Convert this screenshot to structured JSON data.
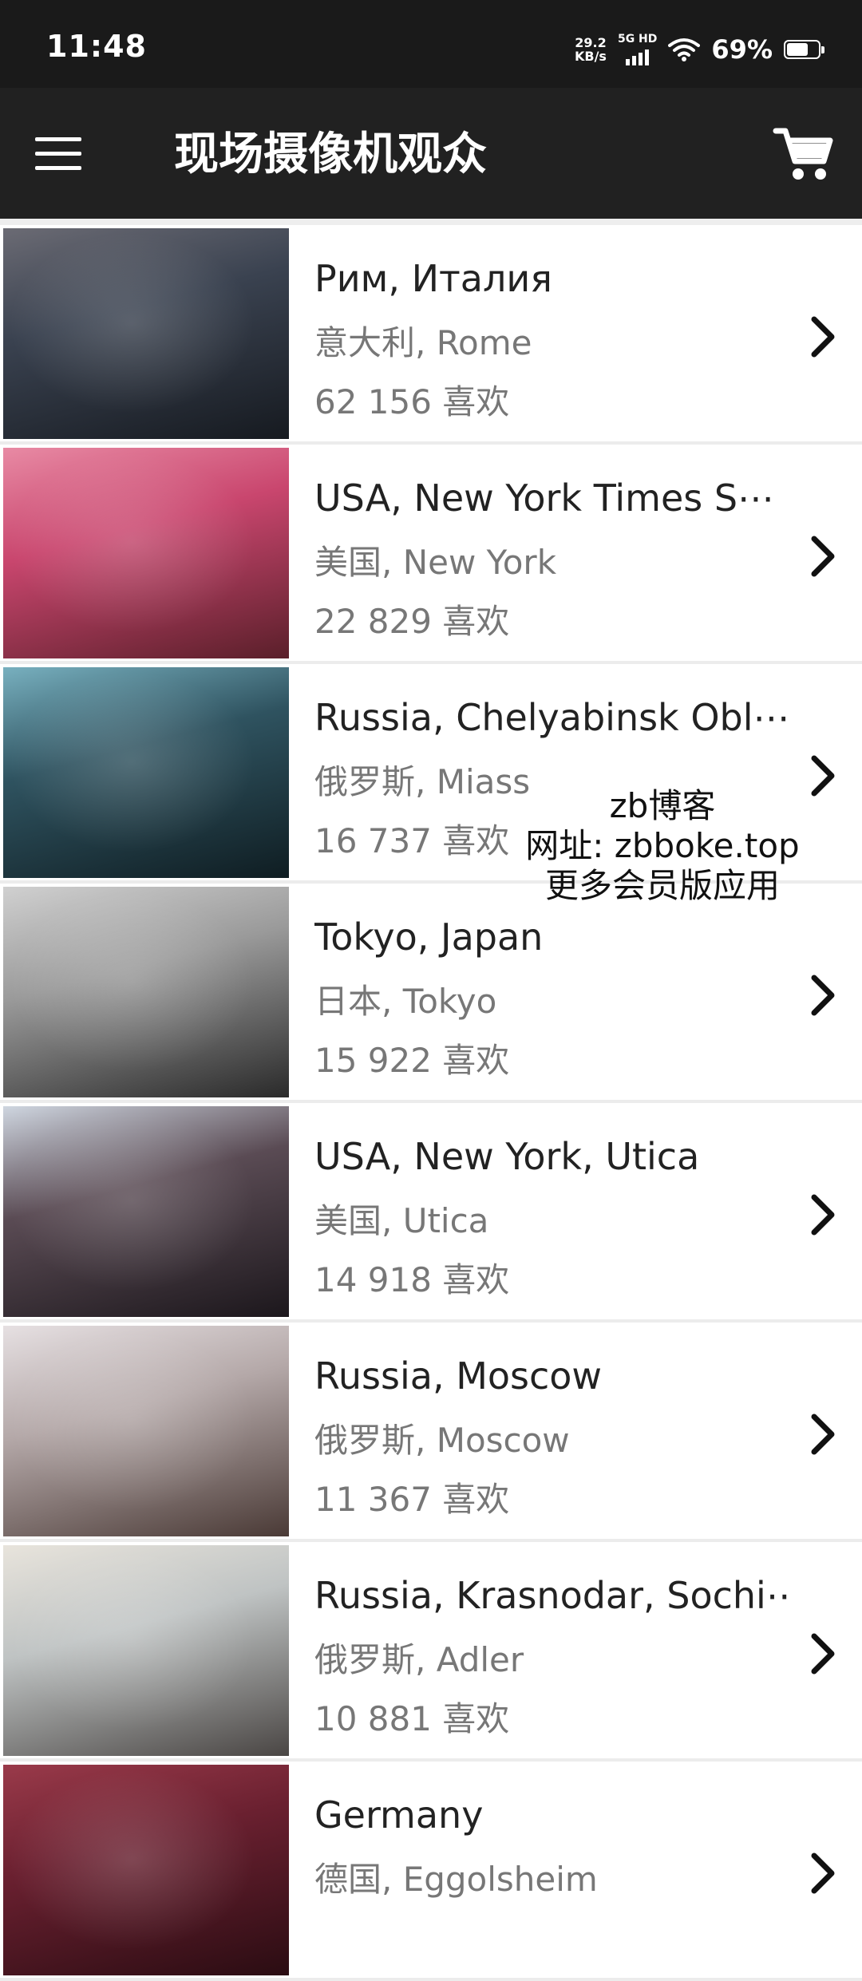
{
  "status": {
    "time": "11:48",
    "net_speed_value": "29.2",
    "net_speed_unit": "KB/s",
    "network": "5G HD",
    "battery_percent": "69%",
    "battery_level": 0.69
  },
  "app_bar": {
    "title": "现场摄像机观众",
    "menu_icon": "hamburger-menu-icon",
    "cart_icon": "shopping-cart-icon"
  },
  "cameras": [
    {
      "title": "Рим, Италия",
      "location": "意大利, Rome",
      "likes": "62 156 喜欢",
      "thumb_colors": [
        "#3a4250",
        "#161a20",
        "#6b6b74"
      ]
    },
    {
      "title": "USA, New York Times S⋯",
      "location": "美国, New York",
      "likes": "22 829 喜欢",
      "thumb_colors": [
        "#c9466e",
        "#5a1f2a",
        "#e88aa4"
      ]
    },
    {
      "title": "Russia, Chelyabinsk Obl⋯",
      "location": "俄罗斯, Miass",
      "likes": "16 737 喜欢",
      "thumb_colors": [
        "#2f5360",
        "#0f1d22",
        "#78b0bf"
      ]
    },
    {
      "title": "Tokyo, Japan",
      "location": "日本, Tokyo",
      "likes": "15 922 喜欢",
      "thumb_colors": [
        "#9a9a9a",
        "#2a2a2a",
        "#d0d0d0"
      ]
    },
    {
      "title": "USA, New York, Utica",
      "location": "美国, Utica",
      "likes": "14 918 喜欢",
      "thumb_colors": [
        "#5a4b54",
        "#1c171c",
        "#cfd6e0"
      ]
    },
    {
      "title": "Russia, Moscow",
      "location": "俄罗斯, Moscow",
      "likes": "11 367 喜欢",
      "thumb_colors": [
        "#b4a8a8",
        "#4a3a36",
        "#e6e0e2"
      ]
    },
    {
      "title": "Russia, Krasnodar, Sochi⋯",
      "location": "俄罗斯, Adler",
      "likes": "10 881 喜欢",
      "thumb_colors": [
        "#bfc3c3",
        "#4a4644",
        "#e8e4dc"
      ]
    },
    {
      "title": "Germany",
      "location": "德国, Eggolsheim",
      "likes": "",
      "thumb_colors": [
        "#6a2030",
        "#2a0c12",
        "#9a3a4a"
      ]
    }
  ],
  "watermark": {
    "line1": "zb博客",
    "line2": "网址: zbboke.top",
    "line3": "更多会员版应用"
  }
}
